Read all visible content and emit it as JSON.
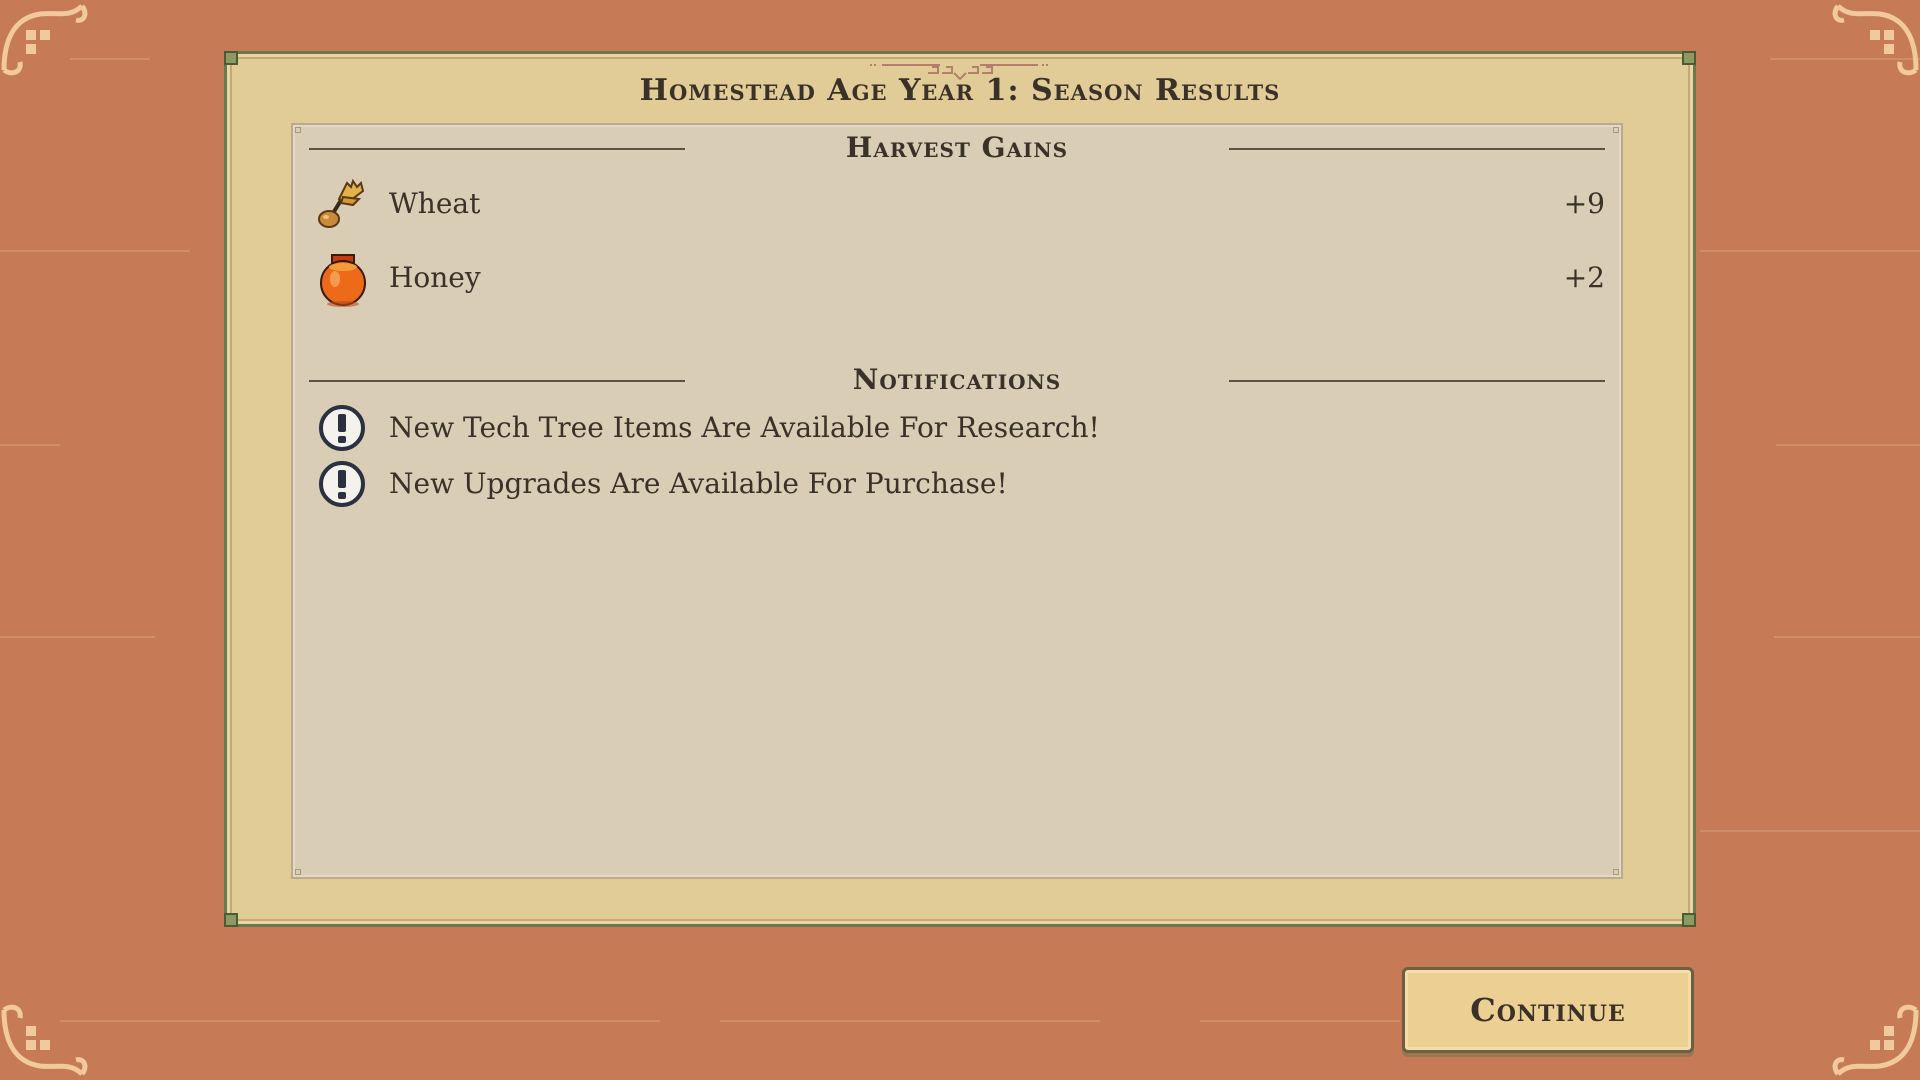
{
  "dialog": {
    "title": "Homestead Age Year 1: Season Results"
  },
  "harvest": {
    "title": "Harvest Gains",
    "items": [
      {
        "icon": "wheat-icon",
        "name": "Wheat",
        "value": "+9"
      },
      {
        "icon": "honey-jar-icon",
        "name": "Honey",
        "value": "+2"
      }
    ]
  },
  "notifications": {
    "title": "Notifications",
    "items": [
      {
        "icon": "exclamation-icon",
        "text": "New Tech Tree Items Are Available For Research!"
      },
      {
        "icon": "exclamation-icon",
        "text": "New Upgrades Are Available For Purchase!"
      }
    ]
  },
  "actions": {
    "continue_label": "Continue"
  },
  "colors": {
    "background": "#c67a55",
    "frame": "#e1cb97",
    "panel": "#d9cdb6",
    "button": "#eccf93",
    "text": "#3a3128"
  }
}
